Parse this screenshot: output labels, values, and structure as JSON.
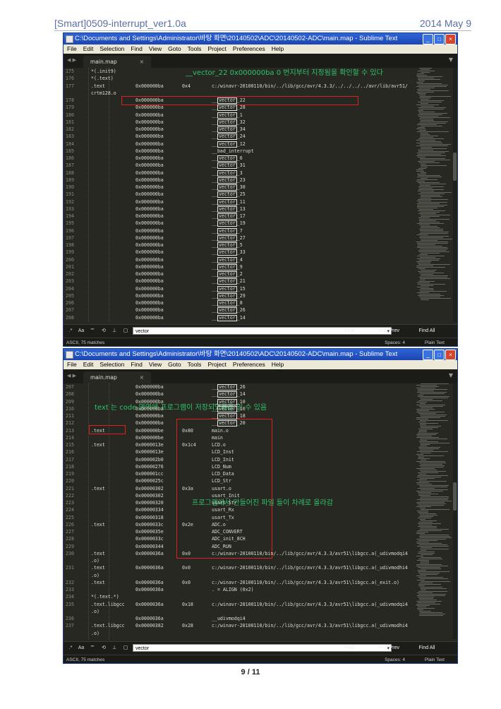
{
  "header": {
    "doc_title": "[Smart]0509-interrupt_ver1.0a",
    "date": "2014 May 9"
  },
  "page_number": "9 / 11",
  "window": {
    "title": "C:\\Documents and Settings\\Administrator\\바탕 화면\\20140502\\ADC\\20140502-ADC\\main.map - Sublime Text",
    "menu": [
      "File",
      "Edit",
      "Selection",
      "Find",
      "View",
      "Goto",
      "Tools",
      "Project",
      "Preferences",
      "Help"
    ],
    "tab": "main.map",
    "tab_close": "×"
  },
  "find_bar": {
    "opt_regex": ".*",
    "opt_case": "Aa",
    "opt_word": "\"\"",
    "search_value": "vector",
    "find": "Find",
    "find_prev": "Find Prev",
    "find_all": "Find All"
  },
  "status": {
    "left": "ASCII, 75 matches",
    "spaces": "Spaces: 4",
    "syntax": "Plain Text"
  },
  "colors": {
    "annotation": "#2ec36a",
    "highlight_box": "#e02020",
    "editor_bg": "#272822",
    "titlebar": "#1c46b2"
  },
  "screen1": {
    "annotation": "__vector_22 0x000000ba 0 번지부터 지정됨을 확인할 수 있다",
    "lines": [
      {
        "ln": "175",
        "a": "*(.init9)",
        "b": "",
        "c": "",
        "d": ""
      },
      {
        "ln": "176",
        "a": "*(.text)",
        "b": "",
        "c": "",
        "d": ""
      },
      {
        "ln": "177",
        "a": ".text",
        "b": "0x000000ba",
        "c": "0x4",
        "d": "c:/winavr-20100110/bin/../lib/gcc/avr/4.3.3/../../../../avr/lib/avr51/"
      },
      {
        "ln": "",
        "a": "crtm128.o",
        "b": "",
        "c": "",
        "d": ""
      },
      {
        "ln": "178",
        "a": "",
        "b": "0x000000ba",
        "c": "",
        "d": "__vector_22"
      },
      {
        "ln": "179",
        "a": "",
        "b": "0x000000ba",
        "c": "",
        "d": "__vector_28"
      },
      {
        "ln": "180",
        "a": "",
        "b": "0x000000ba",
        "c": "",
        "d": "__vector_1"
      },
      {
        "ln": "181",
        "a": "",
        "b": "0x000000ba",
        "c": "",
        "d": "__vector_32"
      },
      {
        "ln": "182",
        "a": "",
        "b": "0x000000ba",
        "c": "",
        "d": "__vector_34"
      },
      {
        "ln": "183",
        "a": "",
        "b": "0x000000ba",
        "c": "",
        "d": "__vector_24"
      },
      {
        "ln": "184",
        "a": "",
        "b": "0x000000ba",
        "c": "",
        "d": "__vector_12"
      },
      {
        "ln": "185",
        "a": "",
        "b": "0x000000ba",
        "c": "",
        "d": "__bad_interrupt"
      },
      {
        "ln": "186",
        "a": "",
        "b": "0x000000ba",
        "c": "",
        "d": "__vector_6"
      },
      {
        "ln": "187",
        "a": "",
        "b": "0x000000ba",
        "c": "",
        "d": "__vector_31"
      },
      {
        "ln": "188",
        "a": "",
        "b": "0x000000ba",
        "c": "",
        "d": "__vector_3"
      },
      {
        "ln": "189",
        "a": "",
        "b": "0x000000ba",
        "c": "",
        "d": "__vector_23"
      },
      {
        "ln": "190",
        "a": "",
        "b": "0x000000ba",
        "c": "",
        "d": "__vector_30"
      },
      {
        "ln": "191",
        "a": "",
        "b": "0x000000ba",
        "c": "",
        "d": "__vector_25"
      },
      {
        "ln": "192",
        "a": "",
        "b": "0x000000ba",
        "c": "",
        "d": "__vector_11"
      },
      {
        "ln": "193",
        "a": "",
        "b": "0x000000ba",
        "c": "",
        "d": "__vector_13"
      },
      {
        "ln": "194",
        "a": "",
        "b": "0x000000ba",
        "c": "",
        "d": "__vector_17"
      },
      {
        "ln": "195",
        "a": "",
        "b": "0x000000ba",
        "c": "",
        "d": "__vector_19"
      },
      {
        "ln": "196",
        "a": "",
        "b": "0x000000ba",
        "c": "",
        "d": "__vector_7"
      },
      {
        "ln": "197",
        "a": "",
        "b": "0x000000ba",
        "c": "",
        "d": "__vector_27"
      },
      {
        "ln": "198",
        "a": "",
        "b": "0x000000ba",
        "c": "",
        "d": "__vector_5"
      },
      {
        "ln": "199",
        "a": "",
        "b": "0x000000ba",
        "c": "",
        "d": "__vector_33"
      },
      {
        "ln": "200",
        "a": "",
        "b": "0x000000ba",
        "c": "",
        "d": "__vector_4"
      },
      {
        "ln": "201",
        "a": "",
        "b": "0x000000ba",
        "c": "",
        "d": "__vector_9"
      },
      {
        "ln": "202",
        "a": "",
        "b": "0x000000ba",
        "c": "",
        "d": "__vector_2"
      },
      {
        "ln": "203",
        "a": "",
        "b": "0x000000ba",
        "c": "",
        "d": "__vector_21"
      },
      {
        "ln": "204",
        "a": "",
        "b": "0x000000ba",
        "c": "",
        "d": "__vector_15"
      },
      {
        "ln": "205",
        "a": "",
        "b": "0x000000ba",
        "c": "",
        "d": "__vector_29"
      },
      {
        "ln": "206",
        "a": "",
        "b": "0x000000ba",
        "c": "",
        "d": "__vector_8"
      },
      {
        "ln": "207",
        "a": "",
        "b": "0x000000ba",
        "c": "",
        "d": "__vector_26"
      },
      {
        "ln": "208",
        "a": "",
        "b": "0x000000ba",
        "c": "",
        "d": "__vector_14"
      }
    ]
  },
  "screen2": {
    "annotation_a": "text 는 code 영역에 프로그램이 저장되었음을 알 수 있음",
    "annotation_b": "프로그램에서 만들어진 파일 들이 차례로 올라감",
    "lines": [
      {
        "ln": "207",
        "a": "",
        "b": "0x000000ba",
        "c": "",
        "d": "__vector_26"
      },
      {
        "ln": "208",
        "a": "",
        "b": "0x000000ba",
        "c": "",
        "d": "__vector_14"
      },
      {
        "ln": "209",
        "a": "",
        "b": "0x000000ba",
        "c": "",
        "d": "__vector_10"
      },
      {
        "ln": "210",
        "a": "",
        "b": "0x000000ba",
        "c": "",
        "d": "__vector_16"
      },
      {
        "ln": "211",
        "a": "",
        "b": "0x000000ba",
        "c": "",
        "d": "__vector_18"
      },
      {
        "ln": "212",
        "a": "",
        "b": "0x000000ba",
        "c": "",
        "d": "__vector_20"
      },
      {
        "ln": "213",
        "a": ".text",
        "b": "0x000000be",
        "c": "0x80",
        "d": "main.o"
      },
      {
        "ln": "214",
        "a": "",
        "b": "0x000000be",
        "c": "",
        "d": "main"
      },
      {
        "ln": "215",
        "a": ".text",
        "b": "0x0000013e",
        "c": "0x1c4",
        "d": "LCD.o"
      },
      {
        "ln": "216",
        "a": "",
        "b": "0x0000013e",
        "c": "",
        "d": "LCD_Inst"
      },
      {
        "ln": "217",
        "a": "",
        "b": "0x000002b0",
        "c": "",
        "d": "LCD_Init"
      },
      {
        "ln": "218",
        "a": "",
        "b": "0x00000276",
        "c": "",
        "d": "LCD_Num"
      },
      {
        "ln": "219",
        "a": "",
        "b": "0x000001cc",
        "c": "",
        "d": "LCD_Data"
      },
      {
        "ln": "220",
        "a": "",
        "b": "0x0000025c",
        "c": "",
        "d": "LCD_Str"
      },
      {
        "ln": "221",
        "a": ".text",
        "b": "0x00000302",
        "c": "0x3a",
        "d": "usart.o"
      },
      {
        "ln": "222",
        "a": "",
        "b": "0x00000302",
        "c": "",
        "d": "usart_Init"
      },
      {
        "ln": "223",
        "a": "",
        "b": "0x00000320",
        "c": "",
        "d": "usart_Str"
      },
      {
        "ln": "224",
        "a": "",
        "b": "0x00000334",
        "c": "",
        "d": "usart_Rx"
      },
      {
        "ln": "225",
        "a": "",
        "b": "0x00000318",
        "c": "",
        "d": "usart_Tx"
      },
      {
        "ln": "226",
        "a": ".text",
        "b": "0x0000033c",
        "c": "0x2e",
        "d": "ADC.o"
      },
      {
        "ln": "227",
        "a": "",
        "b": "0x0000035e",
        "c": "",
        "d": "ADC_CONVERT"
      },
      {
        "ln": "228",
        "a": "",
        "b": "0x0000033c",
        "c": "",
        "d": "ADC_init_8CH"
      },
      {
        "ln": "229",
        "a": "",
        "b": "0x00000344",
        "c": "",
        "d": "ADC_RUN"
      },
      {
        "ln": "230",
        "a": ".text",
        "b": "0x0000036a",
        "c": "0x0",
        "d": "c:/winavr-20100110/bin/../lib/gcc/avr/4.3.3/avr51\\libgcc.a(_udivmodqi4"
      },
      {
        "ln": "",
        "a": ".o)",
        "b": "",
        "c": "",
        "d": ""
      },
      {
        "ln": "231",
        "a": ".text",
        "b": "0x0000036a",
        "c": "0x0",
        "d": "c:/winavr-20100110/bin/../lib/gcc/avr/4.3.3/avr51\\libgcc.a(_udivmodhi4"
      },
      {
        "ln": "",
        "a": ".o)",
        "b": "",
        "c": "",
        "d": ""
      },
      {
        "ln": "232",
        "a": ".text",
        "b": "0x0000036a",
        "c": "0x0",
        "d": "c:/winavr-20100110/bin/../lib/gcc/avr/4.3.3/avr51\\libgcc.a(_exit.o)"
      },
      {
        "ln": "233",
        "a": "",
        "b": "0x0000036a",
        "c": "",
        "d": ". = ALIGN (0x2)"
      },
      {
        "ln": "234",
        "a": "*(.text.*)",
        "b": "",
        "c": "",
        "d": ""
      },
      {
        "ln": "235",
        "a": ".text.libgcc",
        "b": "0x0000036a",
        "c": "0x18",
        "d": "c:/winavr-20100110/bin/../lib/gcc/avr/4.3.3/avr51\\libgcc.a(_udivmodqi4"
      },
      {
        "ln": "",
        "a": ".o)",
        "b": "",
        "c": "",
        "d": ""
      },
      {
        "ln": "236",
        "a": "",
        "b": "0x0000036a",
        "c": "",
        "d": "__udivmodqi4"
      },
      {
        "ln": "237",
        "a": ".text.libgcc",
        "b": "0x00000382",
        "c": "0x28",
        "d": "c:/winavr-20100110/bin/../lib/gcc/avr/4.3.3/avr51\\libgcc.a(_udivmodhi4"
      },
      {
        "ln": "",
        "a": ".o)",
        "b": "",
        "c": "",
        "d": ""
      }
    ]
  }
}
